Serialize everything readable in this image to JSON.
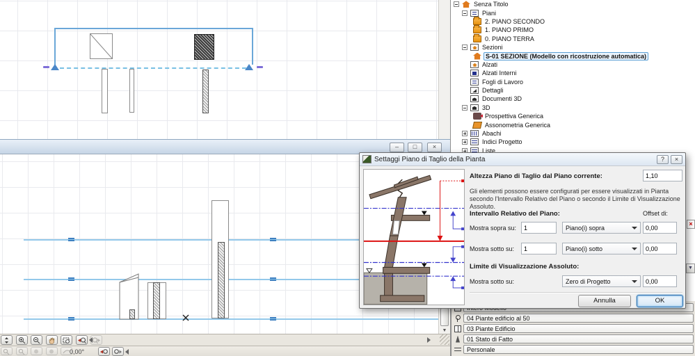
{
  "navigator": {
    "tree": [
      {
        "label": "Senza Titolo",
        "icon": "project-house-icon",
        "expand": "minus",
        "level": 0,
        "selected": false
      },
      {
        "label": "Piani",
        "icon": "story-plan-icon",
        "expand": "minus",
        "level": 1,
        "selected": false
      },
      {
        "label": "2. PIANO SECONDO",
        "icon": "story-folder-icon",
        "expand": "none",
        "level": 2,
        "selected": false
      },
      {
        "label": "1. PIANO PRIMO",
        "icon": "story-folder-icon",
        "expand": "none",
        "level": 2,
        "selected": false
      },
      {
        "label": "0. PIANO TERRA",
        "icon": "story-folder-icon",
        "expand": "none",
        "level": 2,
        "selected": false
      },
      {
        "label": "Sezioni",
        "icon": "section-icon",
        "expand": "minus",
        "level": 1,
        "selected": false
      },
      {
        "label": "S-01 SEZIONE (Modello con ricostruzione automatica)",
        "icon": "section-house-icon",
        "expand": "none",
        "level": 2,
        "selected": true
      },
      {
        "label": "Alzati",
        "icon": "elevation-icon",
        "expand": "none",
        "level": 1,
        "selected": false
      },
      {
        "label": "Alzati Interni",
        "icon": "interior-elevation-icon",
        "expand": "none",
        "level": 1,
        "selected": false
      },
      {
        "label": "Fogli di Lavoro",
        "icon": "worksheet-icon",
        "expand": "none",
        "level": 1,
        "selected": false
      },
      {
        "label": "Dettagli",
        "icon": "detail-icon",
        "expand": "none",
        "level": 1,
        "selected": false
      },
      {
        "label": "Documenti 3D",
        "icon": "document3d-icon",
        "expand": "none",
        "level": 1,
        "selected": false
      },
      {
        "label": "3D",
        "icon": "threed-icon",
        "expand": "minus",
        "level": 1,
        "selected": false
      },
      {
        "label": "Prospettiva Generica",
        "icon": "camera-icon",
        "expand": "none",
        "level": 2,
        "selected": false
      },
      {
        "label": "Assonometria Generica",
        "icon": "axonometry-icon",
        "expand": "none",
        "level": 2,
        "selected": false
      },
      {
        "label": "Abachi",
        "icon": "schedule-icon",
        "expand": "plus",
        "level": 1,
        "selected": false
      },
      {
        "label": "Indici Progetto",
        "icon": "index-icon",
        "expand": "plus",
        "level": 1,
        "selected": false
      },
      {
        "label": "Liste",
        "icon": "list-icon",
        "expand": "plus",
        "level": 1,
        "selected": false
      }
    ],
    "quick_options": [
      {
        "icon": "model-filter-icon",
        "label": "Intero Modello"
      },
      {
        "icon": "pin-icon",
        "label": "04 Piante edificio al 50"
      },
      {
        "icon": "layer-combination-icon",
        "label": "03 Piante Edificio"
      },
      {
        "icon": "pen-set-icon",
        "label": "01 Stato di Fatto"
      },
      {
        "icon": "model-view-options-icon",
        "label": "Personale"
      }
    ]
  },
  "dialog": {
    "title": "Settaggi Piano di Taglio della Pianta",
    "help_glyph": "?",
    "close_glyph": "×",
    "cut_height_label": "Altezza Piano di Taglio dal Piano corrente:",
    "cut_height_value": "1,10",
    "description": "Gli elementi possono essere configurati per essere visualizzati in Pianta secondo l'Intervallo Relativo del Piano o secondo il Limite di Visualizzazione Assoluto.",
    "interval_header": "Intervallo Relativo del Piano:",
    "offset_header": "Offset di:",
    "rows": [
      {
        "label": "Mostra sopra su:",
        "count": "1",
        "select": "Piano(i) sopra",
        "offset": "0,00"
      },
      {
        "label": "Mostra sotto su:",
        "count": "1",
        "select": "Piano(i) sotto",
        "offset": "0,00"
      }
    ],
    "limit_header": "Limite di Visualizzazione Assoluto:",
    "limit_row": {
      "label": "Mostra sotto su:",
      "select": "Zero di Progetto",
      "offset": "0,00"
    },
    "cancel_label": "Annulla",
    "ok_label": "OK"
  },
  "section_window": {
    "minimize_glyph": "–",
    "restore_glyph": "□",
    "close_glyph": "×"
  },
  "statusbar": {
    "angle_value": "0,00°"
  },
  "colors": {
    "section_line_blue": "#6aa7d8",
    "marker_blue": "#4a86c8",
    "marker_purple": "#7e6fd8",
    "story_line_blue": "#93c8ea",
    "cut_plane_red": "#dd1111",
    "selection_blue": "#5a9fd4"
  }
}
